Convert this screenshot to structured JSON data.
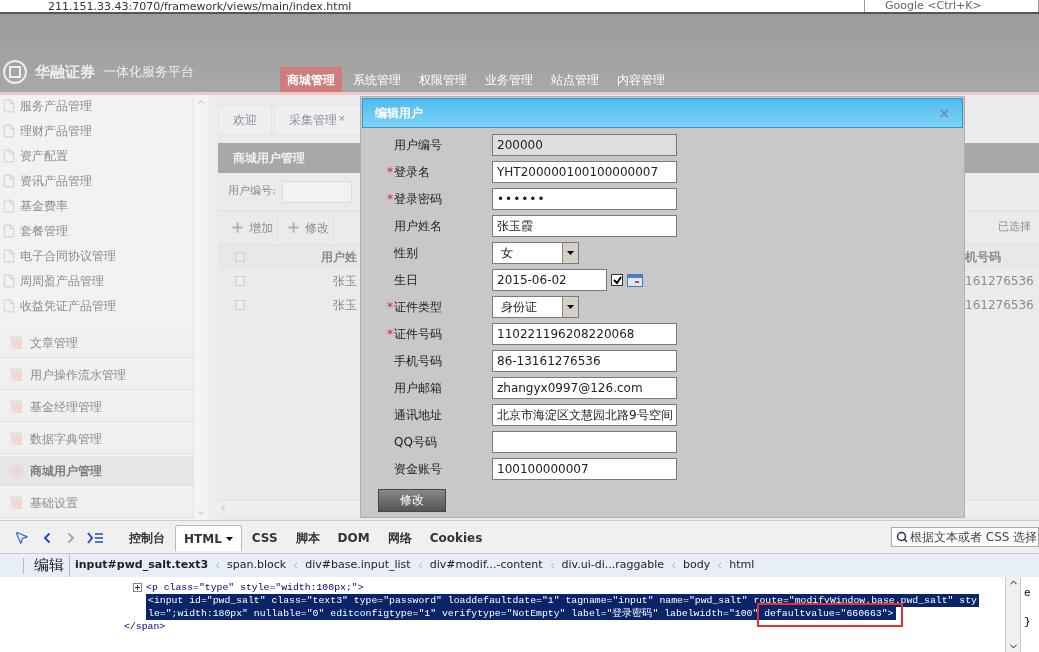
{
  "browser": {
    "url": "211.151.33.43:7070/framework/views/main/index.html",
    "search_placeholder": "Google <Ctrl+K>"
  },
  "header": {
    "logo_name": "华融证券",
    "platform": "一体化服务平台",
    "nav": [
      {
        "label": "商城管理",
        "selected": true
      },
      {
        "label": "系统管理",
        "selected": false
      },
      {
        "label": "权限管理",
        "selected": false
      },
      {
        "label": "业务管理",
        "selected": false
      },
      {
        "label": "站点管理",
        "selected": false
      },
      {
        "label": "内容管理",
        "selected": false
      }
    ]
  },
  "sidebar": {
    "sub_items": [
      "服务产品管理",
      "理财产品管理",
      "资产配置",
      "资讯产品管理",
      "基金费率",
      "套餐管理",
      "电子合同协议管理",
      "周周盈产品管理",
      "收益凭证产品管理"
    ],
    "groups": [
      {
        "label": "文章管理",
        "selected": false
      },
      {
        "label": "用户操作流水管理",
        "selected": false
      },
      {
        "label": "基金经理管理",
        "selected": false
      },
      {
        "label": "数据字典管理",
        "selected": false
      },
      {
        "label": "商城用户管理",
        "selected": true
      },
      {
        "label": "基础设置",
        "selected": false
      }
    ]
  },
  "content": {
    "tabs": [
      {
        "label": "欢迎",
        "closable": false
      },
      {
        "label": "采集管理",
        "closable": true
      }
    ],
    "tab_close": "×",
    "panel_title": "商城用户管理",
    "search_label": "用户编号:",
    "toolbar": [
      "增加",
      "修改"
    ],
    "selection_note": "已选择",
    "table": {
      "header_checked": false,
      "columns": [
        "用户姓",
        "机号码"
      ],
      "rows": [
        {
          "checked": false,
          "cells": [
            "张玉",
            "161276536"
          ]
        },
        {
          "checked": false,
          "cells": [
            "张玉",
            "161276536"
          ]
        }
      ]
    }
  },
  "dialog": {
    "title": "编辑用户",
    "close": "×",
    "required_mark": "*",
    "submit": "修改",
    "fields": [
      {
        "label": "用户编号",
        "required": false,
        "kind": "readonly",
        "value": "200000"
      },
      {
        "label": "登录名",
        "required": true,
        "kind": "text",
        "value": "YHT200000100100000007"
      },
      {
        "label": "登录密码",
        "required": true,
        "kind": "password",
        "value": "••••••"
      },
      {
        "label": "用户姓名",
        "required": false,
        "kind": "text",
        "value": "张玉霞"
      },
      {
        "label": "性别",
        "required": false,
        "kind": "select",
        "value": "女"
      },
      {
        "label": "生日",
        "required": false,
        "kind": "date",
        "value": "2015-06-02",
        "checked": true
      },
      {
        "label": "证件类型",
        "required": true,
        "kind": "select",
        "value": "身份证"
      },
      {
        "label": "证件号码",
        "required": true,
        "kind": "text",
        "value": "110221196208220068"
      },
      {
        "label": "手机号码",
        "required": false,
        "kind": "text",
        "value": "86-13161276536"
      },
      {
        "label": "用户邮箱",
        "required": false,
        "kind": "text",
        "value": "zhangyx0997@126.com"
      },
      {
        "label": "通讯地址",
        "required": false,
        "kind": "text",
        "value": "北京市海淀区文慧园北路9号空间"
      },
      {
        "label": "QQ号码",
        "required": false,
        "kind": "text"
      },
      {
        "label": "资金账号",
        "required": false,
        "kind": "text",
        "value": "100100000007"
      }
    ]
  },
  "devtools": {
    "tabs": [
      {
        "label": "控制台",
        "selected": false,
        "menu": false
      },
      {
        "label": "HTML",
        "selected": true,
        "menu": true
      },
      {
        "label": "CSS",
        "selected": false,
        "menu": false
      },
      {
        "label": "脚本",
        "selected": false,
        "menu": false
      },
      {
        "label": "DOM",
        "selected": false,
        "menu": false
      },
      {
        "label": "网络",
        "selected": false,
        "menu": false
      },
      {
        "label": "Cookies",
        "selected": false,
        "menu": false
      }
    ],
    "search_placeholder": "根据文本或者 CSS 选择",
    "edit": "编辑",
    "breadcrumbs": [
      {
        "label": "input#pwd_salt.text3",
        "current": true
      },
      {
        "label": "span.block",
        "current": false
      },
      {
        "label": "div#base.input_list",
        "current": false
      },
      {
        "label": "div#modif...-content",
        "current": false
      },
      {
        "label": "div.ui-di...raggable",
        "current": false
      },
      {
        "label": "body",
        "current": false
      },
      {
        "label": "html",
        "current": false
      }
    ],
    "lines": [
      {
        "kind": "element",
        "selected": false,
        "text": "<p class=\"type\" style=\"width:100px;\">"
      },
      {
        "kind": "leaf",
        "selected": true,
        "text": "<input id=\"pwd_salt\" class=\"text3\" type=\"password\" loaddefaultdate=\"1\" tagname=\"input\" name=\"pwd_salt\" route=\"modifyWindow.base.pwd_salt\" sty"
      },
      {
        "kind": "leaf",
        "selected": true,
        "text": "le=\";width:180px\" nullable=\"0\" editconfigtype=\"1\" verifytype=\"NotEmpty\" label=\"登录密码\" labelwidth=\"100\" defaultvalue=\"660663\">"
      },
      {
        "kind": "closing",
        "selected": false,
        "text": "</span>"
      }
    ],
    "side_text": [
      "e",
      "}"
    ]
  }
}
